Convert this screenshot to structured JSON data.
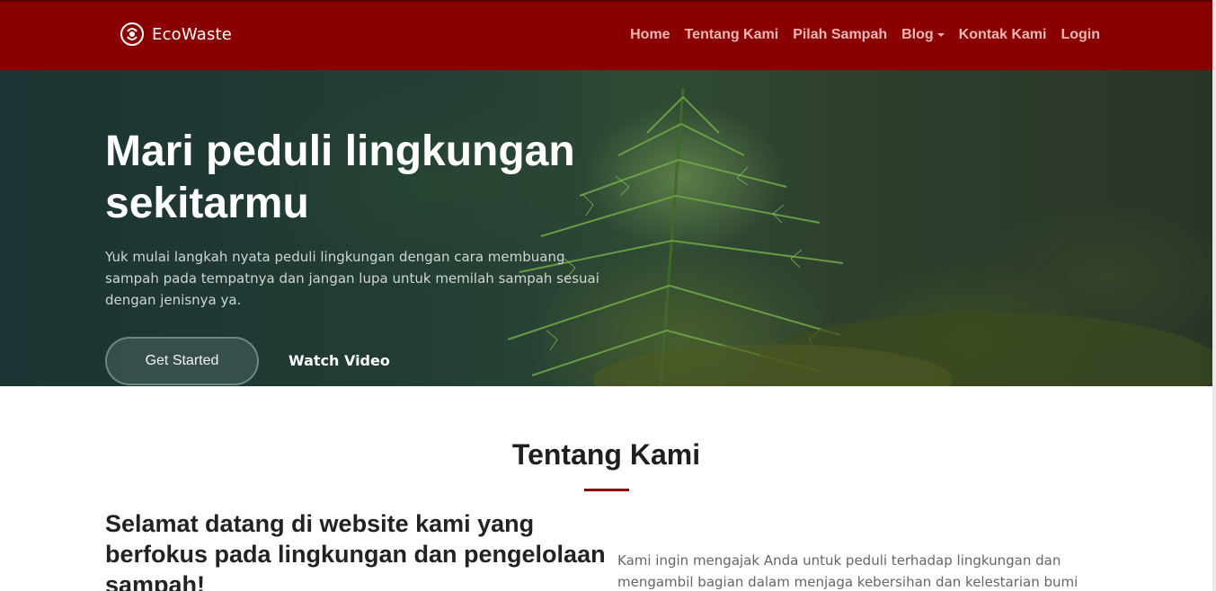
{
  "brand": {
    "name": "EcoWaste",
    "logo_icon": "recycle-logo-icon"
  },
  "nav": {
    "items": [
      {
        "label": "Home"
      },
      {
        "label": "Tentang Kami"
      },
      {
        "label": "Pilah Sampah"
      },
      {
        "label": "Blog",
        "has_dropdown": true
      },
      {
        "label": "Kontak Kami"
      },
      {
        "label": "Login"
      }
    ]
  },
  "hero": {
    "title": "Mari peduli lingkungan sekitarmu",
    "subtitle": "Yuk mulai langkah nyata peduli lingkungan dengan cara membuang sampah pada tempatnya dan jangan lupa untuk memilah sampah sesuai dengan jenisnya ya.",
    "primary_button": "Get Started",
    "secondary_button": "Watch Video"
  },
  "about": {
    "title": "Tentang Kami",
    "lead": "Selamat datang di website kami yang berfokus pada lingkungan dan pengelolaan sampah!",
    "text": "Kami ingin mengajak Anda untuk peduli terhadap lingkungan dan mengambil bagian dalam menjaga kebersihan dan kelestarian bumi kita."
  },
  "colors": {
    "navbar": "#8a0000",
    "nav_link": "#f0b7b7",
    "accent_line": "#8a0000"
  }
}
